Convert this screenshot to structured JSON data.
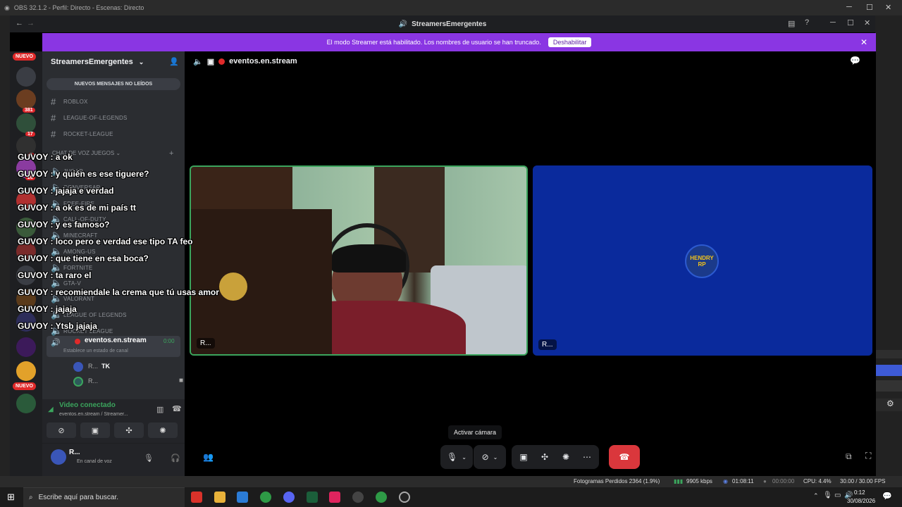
{
  "obs": {
    "window_title": "OBS 32.1.2 - Perfil: Directo - Escenas: Directo",
    "status": {
      "dropped_frames": "Fotogramas Perdidos 2364 (1.9%)",
      "bitrate": "9905 kbps",
      "stream_time": "01:08:11",
      "rec_time": "00:00:00",
      "cpu": "CPU: 4.4%",
      "fps": "30.00 / 30.00 FPS"
    }
  },
  "discord": {
    "title": "StreamersEmergentes",
    "banner": {
      "text": "El modo Streamer está habilitado. Los nombres de usuario se han truncado.",
      "button": "Deshabilitar"
    },
    "server_rail": {
      "badges": [
        "NUEVO",
        "381",
        "17",
        "2",
        "26",
        "NUEVO"
      ]
    },
    "sidebar": {
      "server_name": "StreamersEmergentes",
      "unread_button": "NUEVOS MENSAJES NO LEÍDOS",
      "text_channels": [
        "ROBLOX",
        "LEAGUE-OF-LEGENDS",
        "ROCKET-LEAGUE"
      ],
      "voice_category": "CHAT DE VOZ JUEGOS",
      "voice_channels": [
        "JUGAR",
        "CONVERSAR",
        "FREE-FIRE",
        "CALL-OF-DUTY",
        "MINECRAFT",
        "AMONG-US",
        "FORTNITE",
        "GTA-V",
        "VALORANT",
        "LEAGUE OF LEGENDS",
        "ROCKET LEAGUE"
      ],
      "active_voice": {
        "name": "eventos.en.stream",
        "timer": "0:00",
        "status": "Establece un estado de canal"
      },
      "participants": [
        {
          "name": "R...",
          "tag": "TK"
        },
        {
          "name": "R...",
          "tag": ""
        }
      ],
      "vc_panel": {
        "status": "Video conectado",
        "location": "eventos.en.stream / Streamer..."
      },
      "user": {
        "name": "R...",
        "status": "En canal de voz"
      }
    },
    "stage": {
      "channel": "eventos.en.stream",
      "tiles": [
        {
          "label": "R..."
        },
        {
          "label": "R...",
          "avatar_text": "HENDRY RP"
        }
      ],
      "tooltip": "Activar cámara"
    }
  },
  "chat_overlay": [
    {
      "nick": "GUVOY",
      "msg": "a ok"
    },
    {
      "nick": "GUVOY",
      "msg": "y quién es ese tiguere?"
    },
    {
      "nick": "GUVOY",
      "msg": "jajaja e verdad"
    },
    {
      "nick": "GUVOY",
      "msg": "a ok es de mi país tt"
    },
    {
      "nick": "GUVOY",
      "msg": "y es famoso?"
    },
    {
      "nick": "GUVOY",
      "msg": "loco pero e verdad ese tipo TA feo"
    },
    {
      "nick": "GUVOY",
      "msg": "que tiene en esa boca?"
    },
    {
      "nick": "GUVOY",
      "msg": "ta raro el"
    },
    {
      "nick": "GUVOY",
      "msg": "recomiendale la crema que tú usas amor"
    },
    {
      "nick": "GUVOY",
      "msg": "jajaja"
    },
    {
      "nick": "GUVOY",
      "msg": "Ytsb jajaja"
    }
  ],
  "taskbar": {
    "search_placeholder": "Escribe aquí para buscar.",
    "time": "0:12",
    "date": "30/08/2026"
  },
  "colors": {
    "banner": "#8a36e3",
    "speaking": "#3ba55d",
    "hangup": "#da373c",
    "tile_blue": "#0a2a9c"
  }
}
